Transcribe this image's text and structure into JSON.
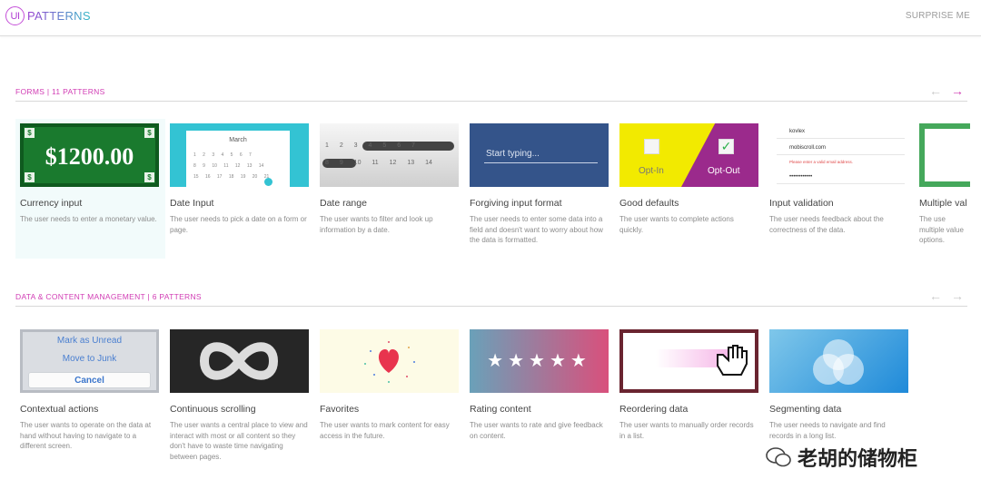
{
  "header": {
    "logo_badge": "UI",
    "logo_text": "PATTERNS",
    "surprise_label": "SURPRISE ME"
  },
  "forms_section": {
    "title": "FORMS | 11 PATTERNS",
    "cards": [
      {
        "title": "Currency input",
        "desc": "The user needs to enter a monetary value.",
        "thumb_text": "$1200.00",
        "corner_symbol": "$"
      },
      {
        "title": "Date Input",
        "desc": "The user needs to pick a date on a form or page.",
        "thumb_month": "March",
        "thumb_rows": [
          "1 2 3 4 5 6 7",
          "8 9 10 11 12 13 14",
          "15 16 17 18 19 20 21"
        ]
      },
      {
        "title": "Date range",
        "desc": "The user wants to filter and look up information by a date.",
        "thumb_rows": [
          "1 2 3 4 5 6 7",
          "8 9 10 11 12 13 14"
        ]
      },
      {
        "title": "Forgiving input format",
        "desc": "The user needs to enter some data into a field and doesn't want to worry about how the data is formatted.",
        "thumb_placeholder": "Start typing..."
      },
      {
        "title": "Good defaults",
        "desc": "The user wants to complete actions quickly.",
        "opt_in": "Opt-In",
        "opt_out": "Opt-Out"
      },
      {
        "title": "Input validation",
        "desc": "The user needs feedback about the correctness of the data.",
        "field_user": "kovlex",
        "field_email": "mobiscroll.com",
        "error": "Please enter a valid email address.",
        "field_pass": "••••••••••••"
      },
      {
        "title": "Multiple val",
        "desc": "The use multiple value options."
      }
    ]
  },
  "data_section": {
    "title": "DATA & CONTENT MANAGEMENT | 6 PATTERNS",
    "cards": [
      {
        "title": "Contextual actions",
        "desc": "The user wants to operate on the data at hand without having to navigate to a different screen.",
        "opt1": "Mark as Unread",
        "opt2": "Move to Junk",
        "cancel": "Cancel"
      },
      {
        "title": "Continuous scrolling",
        "desc": "The user wants a central place to view and interact with most or all content so they don't have to waste time navigating between pages."
      },
      {
        "title": "Favorites",
        "desc": "The user wants to mark content for easy access in the future."
      },
      {
        "title": "Rating content",
        "desc": "The user wants to rate and give feedback on content.",
        "stars": "★★★★★"
      },
      {
        "title": "Reordering data",
        "desc": "The user wants to manually order records in a list."
      },
      {
        "title": "Segmenting data",
        "desc": "The user needs to navigate and find records in a long list."
      }
    ]
  },
  "watermark": "老胡的储物柜",
  "colors": {
    "accent": "#d13cb4",
    "brand": "#9b3fd2",
    "muted_arrow": "#c8c8c8"
  }
}
